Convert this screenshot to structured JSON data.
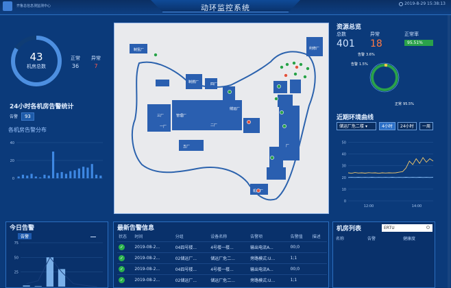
{
  "header": {
    "subtitle": "齐鲁总信息测监测中心",
    "title": "动环监控系统",
    "datetime": "2019-8-29 15:38:13"
  },
  "rooms": {
    "total": "43",
    "total_label": "机房总数",
    "normal_label": "正常",
    "normal_value": "36",
    "abnormal_label": "异常",
    "abnormal_value": "7"
  },
  "alarm_stats": {
    "title": "24小时各机房告警统计",
    "count_label": "告警",
    "count_value": "93",
    "distribution_title": "各机房告警分布"
  },
  "resources": {
    "title": "资源总览",
    "total_label": "总数",
    "total_value": "401",
    "abnormal_label": "异常",
    "abnormal_value": "18",
    "rate_label": "正常率",
    "rate_value": "95.51%",
    "ring_labels": [
      {
        "name": "告警",
        "pct": "3.6%"
      },
      {
        "name": "告警",
        "pct": "1.5%"
      },
      {
        "name": "正常",
        "pct": "95.5%"
      }
    ]
  },
  "env": {
    "title": "近期环境曲线",
    "select_value": "储运厂危二楼",
    "range_buttons": [
      "4小时",
      "24小时",
      "一周"
    ],
    "active_range": "4小时"
  },
  "today": {
    "title": "今日告警",
    "tab": "告警"
  },
  "recent": {
    "title": "最新告警信息",
    "columns": [
      "状态",
      "时间",
      "分组",
      "设备名称",
      "告警项",
      "告警值",
      "描述"
    ],
    "rows": [
      {
        "time": "2019-08-2...",
        "group": "04四号楼...",
        "device": "4号楼一楼...",
        "item": "输出电流A...",
        "value": "00;0",
        "desc": ""
      },
      {
        "time": "2019-08-2...",
        "group": "02储运厂...",
        "device": "储运厂危二...",
        "item": "旁路模式:U...",
        "value": "1;1",
        "desc": ""
      },
      {
        "time": "2019-08-2...",
        "group": "04四号楼...",
        "device": "4号楼一楼...",
        "item": "输出电流A...",
        "value": "00;0",
        "desc": ""
      },
      {
        "time": "2019-08-2...",
        "group": "02储运厂...",
        "device": "储运厂危二...",
        "item": "旁路模式:U...",
        "value": "1;1",
        "desc": ""
      }
    ]
  },
  "room_list": {
    "title": "机房列表",
    "search_value": "ERTU",
    "columns": [
      "名称",
      "告警",
      "健康度"
    ]
  },
  "map": {
    "building_labels": [
      "制氢厂",
      "制燃厂",
      "四厂",
      "三厂",
      "管理厂",
      "储运厂",
      "一厂",
      "二厂",
      "五厂",
      "机动厂",
      "厂",
      "利修厂"
    ]
  },
  "chart_data": [
    {
      "type": "bar",
      "title": "各机房告警分布",
      "yticks": [
        0,
        20,
        40
      ],
      "ylim": [
        0,
        40
      ],
      "values": [
        2,
        4,
        3,
        5,
        2,
        1,
        4,
        3,
        30,
        6,
        7,
        5,
        8,
        9,
        11,
        13,
        12,
        16,
        4,
        3
      ],
      "categories_visible": false
    },
    {
      "type": "line",
      "title": "近期环境曲线",
      "yticks": [
        50,
        40,
        30,
        20,
        10,
        0
      ],
      "ylim": [
        0,
        55
      ],
      "xticks": [
        "12:00",
        "14:00"
      ],
      "series": [
        {
          "color": "#f2c86a",
          "values": [
            24,
            23.6,
            24.2,
            23.8,
            24,
            23.7,
            24.1,
            23.9,
            24,
            23.6,
            24,
            23.8,
            24,
            23.9,
            24,
            24.5,
            25,
            28,
            34,
            31,
            36,
            32,
            37,
            33,
            36,
            34
          ]
        },
        {
          "color": "#8fc6ff",
          "values": [
            20,
            20.1,
            20,
            20.2,
            20,
            20.1,
            20,
            20.2,
            20,
            20.1,
            20,
            20.1,
            20,
            20.2,
            20,
            20.1,
            20,
            20.2,
            20,
            20.1,
            20,
            20.2,
            20,
            20.1,
            20,
            20.1
          ]
        }
      ]
    },
    {
      "type": "bar",
      "title": "今日告警",
      "yticks": [
        75,
        50,
        25
      ],
      "ylim": [
        0,
        75
      ],
      "values": [
        2,
        1,
        50,
        30,
        0,
        0,
        0
      ],
      "line": [
        5,
        10,
        50,
        25,
        5,
        2,
        0
      ]
    }
  ]
}
